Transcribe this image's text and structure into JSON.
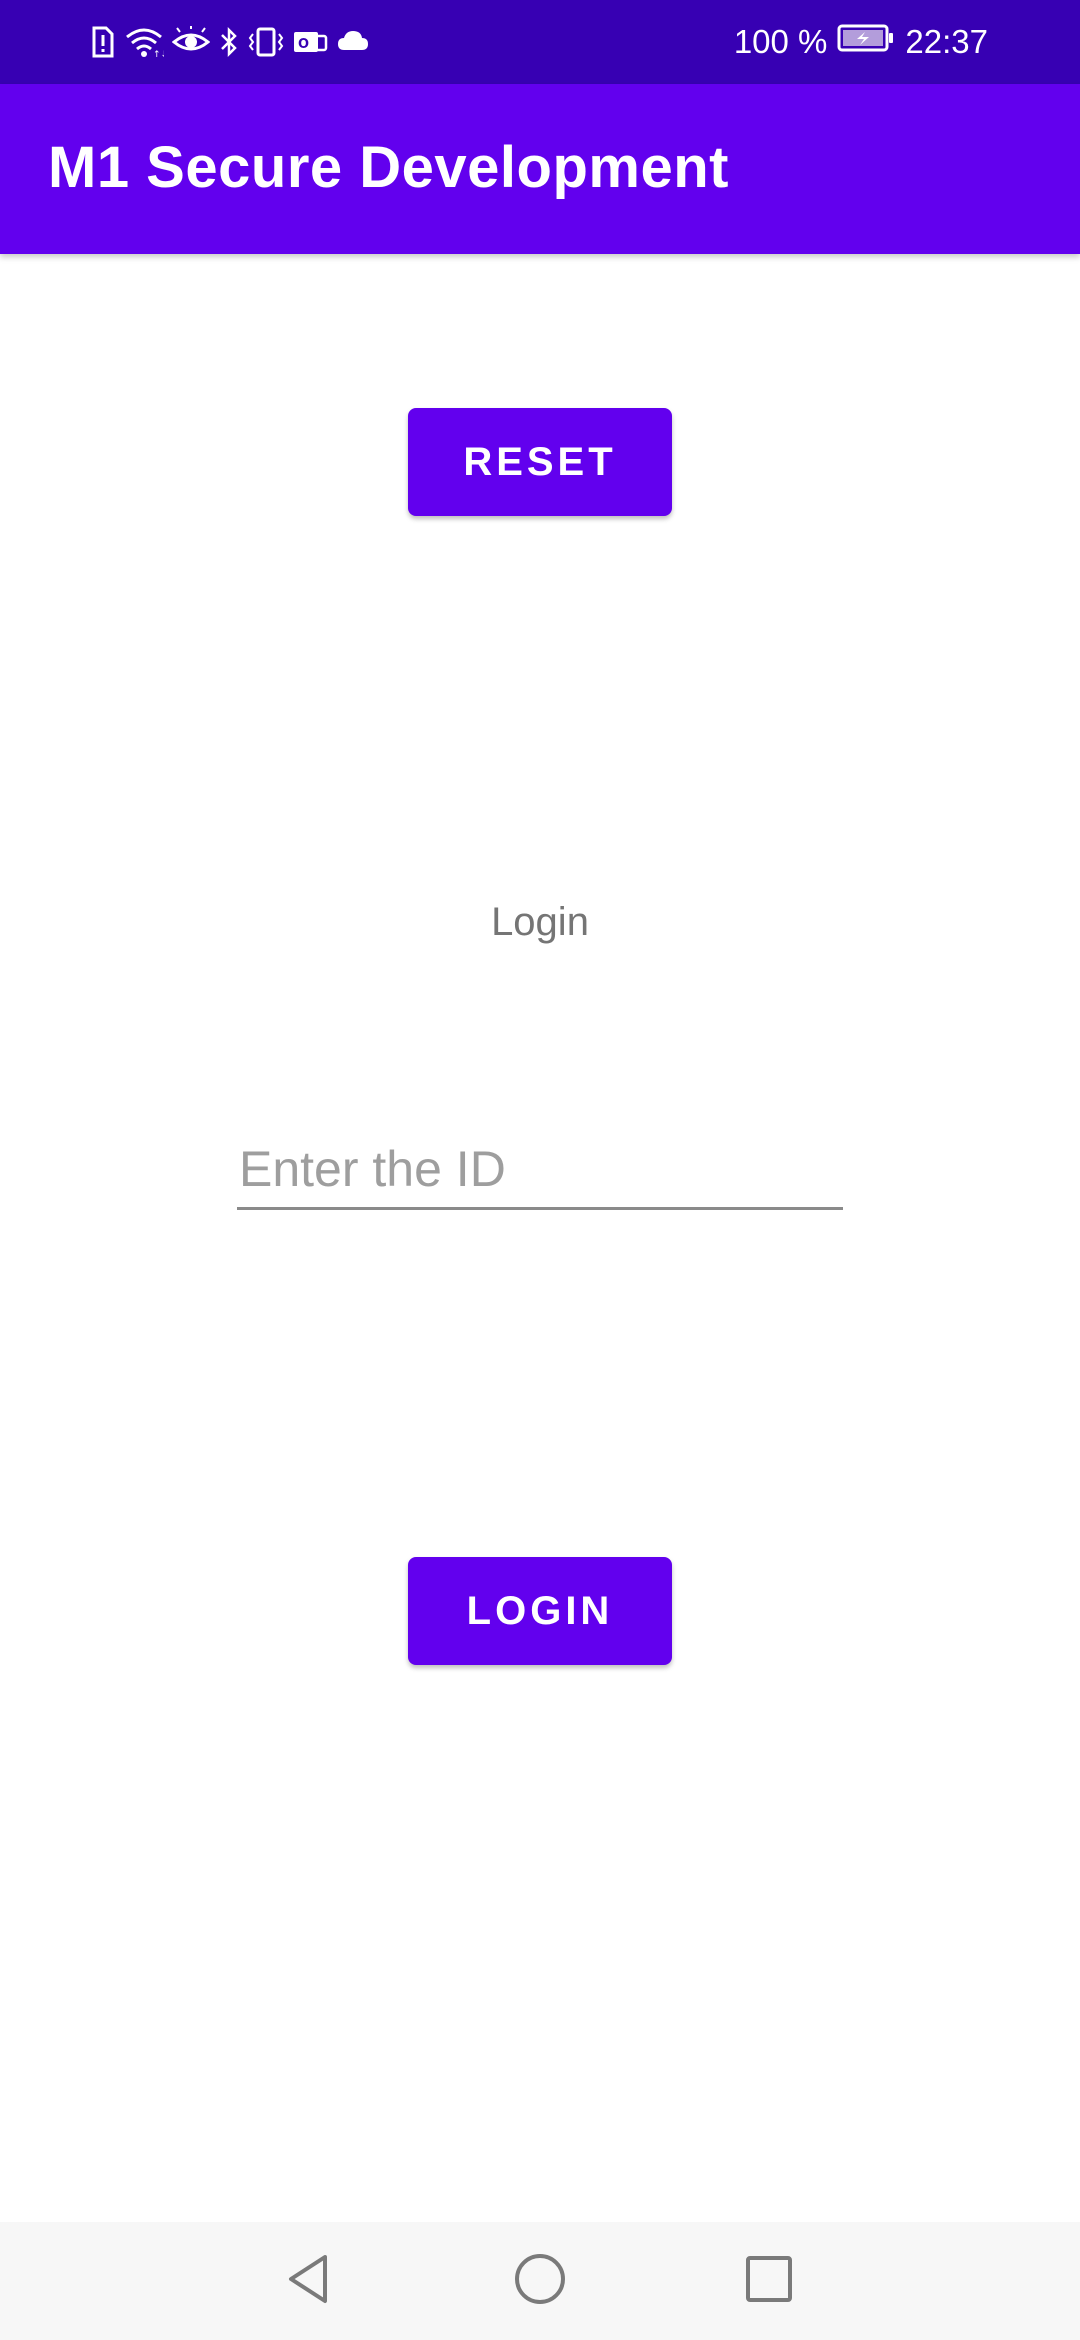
{
  "status_bar": {
    "battery_percent": "100 %",
    "time": "22:37",
    "background_color": "#3700b3",
    "icons": [
      "sim-alert-icon",
      "wifi-icon",
      "eye-icon",
      "bluetooth-icon",
      "vibrate-icon",
      "messenger-icon",
      "cloud-icon",
      "battery-charging-icon"
    ]
  },
  "app_bar": {
    "title": "M1 Secure Development",
    "background_color": "#6200ee"
  },
  "main": {
    "reset_label": "RESET",
    "login_label": "Login",
    "id_field": {
      "value": "",
      "placeholder": "Enter the ID"
    },
    "login_button_label": "LOGIN"
  },
  "nav_bar": {
    "icons": [
      "back-icon",
      "home-icon",
      "recent-apps-icon"
    ]
  }
}
